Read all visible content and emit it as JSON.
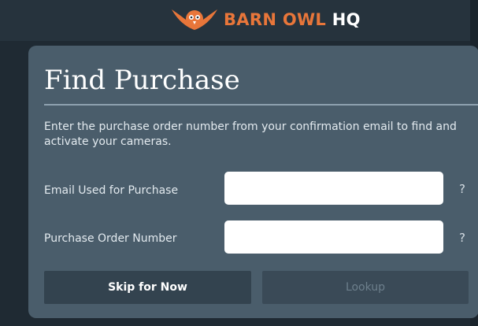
{
  "header": {
    "brand_main": "BARN OWL",
    "brand_sub": "HQ",
    "logo_icon": "owl-logo-icon",
    "brand_color": "#e8763a"
  },
  "card": {
    "title": "Find Purchase",
    "description": "Enter the purchase order number from your confirmation email to find and activate your cameras.",
    "fields": [
      {
        "label": "Email Used for Purchase",
        "value": "",
        "help": "?"
      },
      {
        "label": "Purchase Order Number",
        "value": "",
        "help": "?"
      }
    ],
    "buttons": {
      "skip_label": "Skip for Now",
      "lookup_label": "Lookup"
    }
  }
}
